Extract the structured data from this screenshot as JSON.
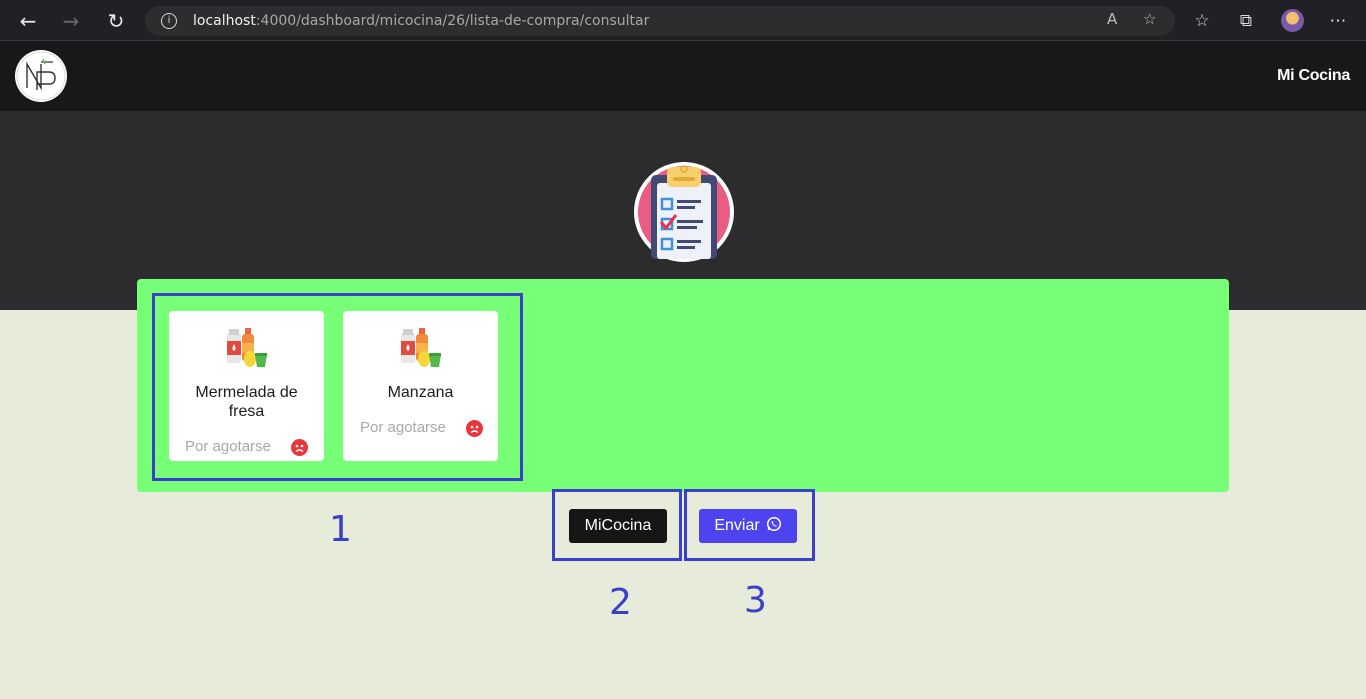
{
  "browser": {
    "url_host": "localhost",
    "url_rest": ":4000/dashboard/micocina/26/lista-de-compra/consultar",
    "nav": {
      "back_icon": "arrow-left-icon",
      "forward_icon": "arrow-right-icon",
      "refresh_icon": "refresh-icon"
    }
  },
  "nav": {
    "brand_label": "Mi Cocina"
  },
  "products": [
    {
      "name": "Mermelada de fresa",
      "status": "Por agotarse"
    },
    {
      "name": "Manzana",
      "status": "Por agotarse"
    }
  ],
  "actions": {
    "micocina_label": "MiCocina",
    "enviar_label": "Enviar"
  },
  "annotations": [
    "1",
    "2",
    "3"
  ],
  "colors": {
    "panel": "#78ff78",
    "nav_bg": "#18181b",
    "hero_bg": "#2c2c2e",
    "page_bg": "#e6ebda",
    "button_dark": "#161616",
    "button_blue": "#4e44ef",
    "annotation": "#3b40c8",
    "status_sad": "#e8373b"
  }
}
